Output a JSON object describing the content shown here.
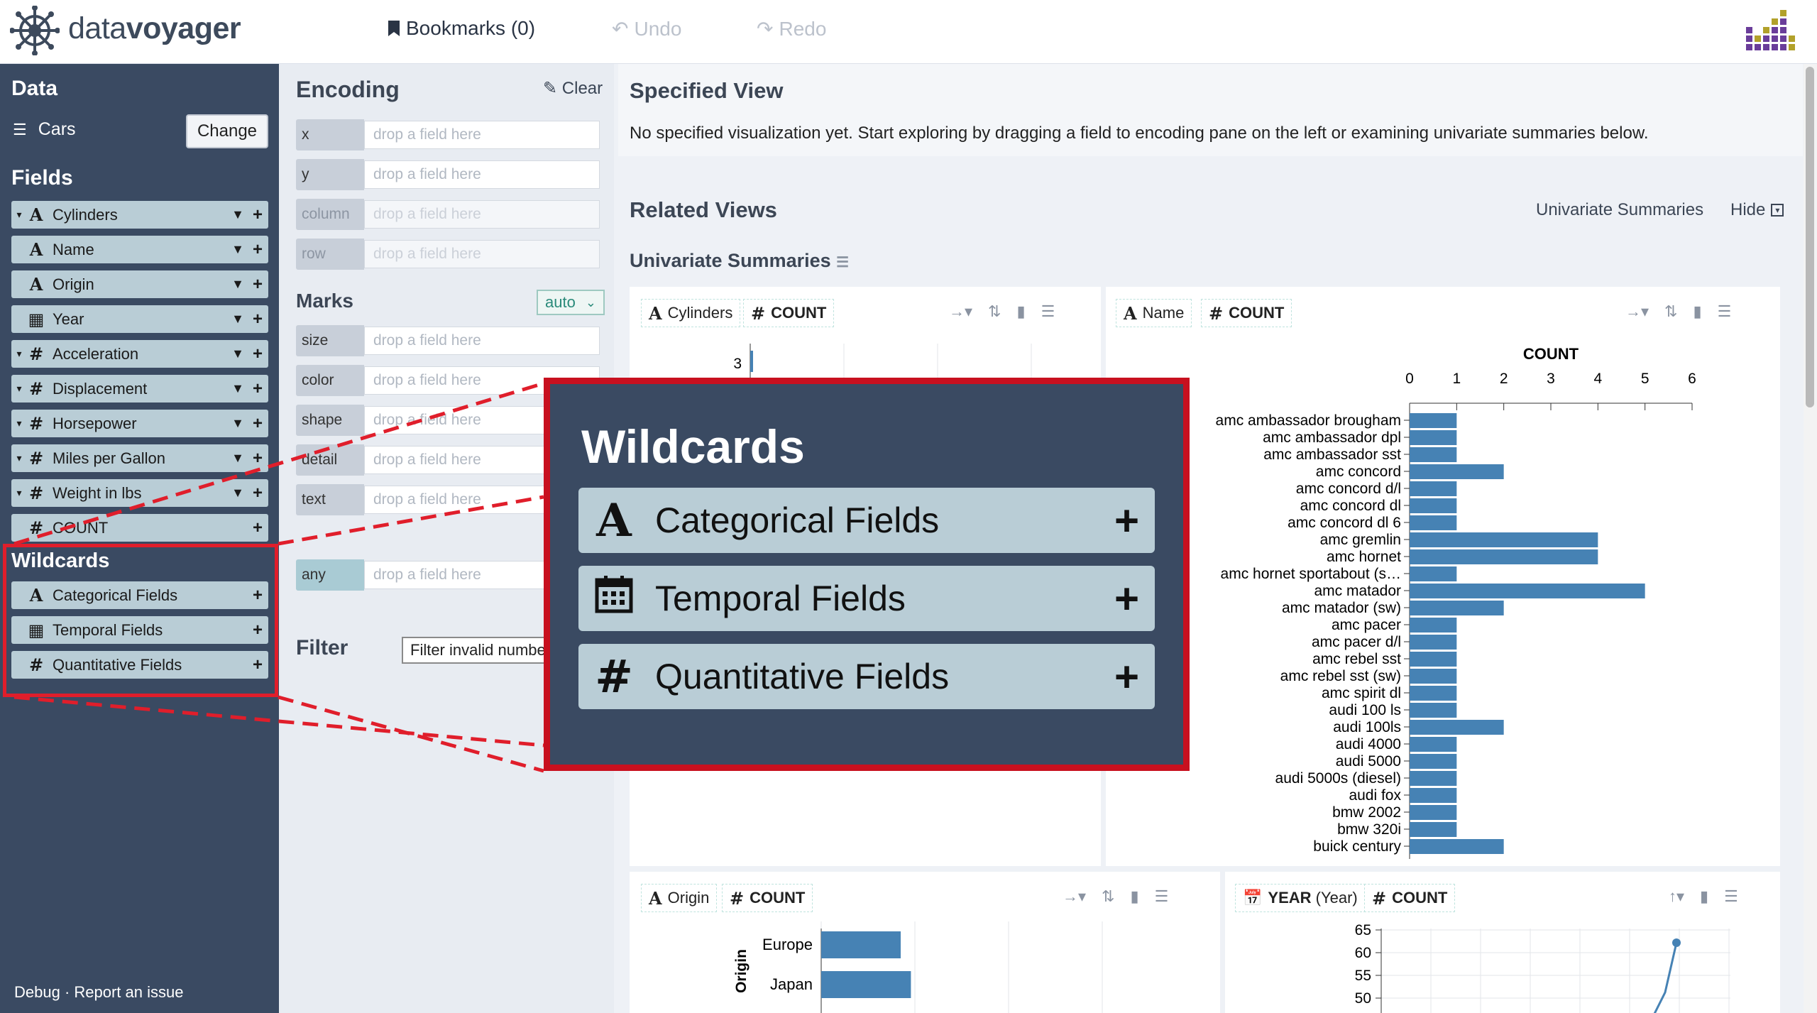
{
  "app": {
    "name_light": "data",
    "name_bold": "voyager"
  },
  "toolbar": {
    "bookmarks": "Bookmarks (0)",
    "undo": "Undo",
    "redo": "Redo"
  },
  "data_pane": {
    "title": "Data",
    "dataset": "Cars",
    "change_label": "Change",
    "fields_title": "Fields",
    "fields": [
      {
        "type": "A",
        "name": "Cylinders",
        "caret": true,
        "filter": true
      },
      {
        "type": "A",
        "name": "Name",
        "caret": false,
        "filter": true
      },
      {
        "type": "A",
        "name": "Origin",
        "caret": false,
        "filter": true
      },
      {
        "type": "calendar",
        "name": "Year",
        "caret": false,
        "filter": true
      },
      {
        "type": "#",
        "name": "Acceleration",
        "caret": true,
        "filter": true
      },
      {
        "type": "#",
        "name": "Displacement",
        "caret": true,
        "filter": true
      },
      {
        "type": "#",
        "name": "Horsepower",
        "caret": true,
        "filter": true
      },
      {
        "type": "#",
        "name": "Miles per Gallon",
        "caret": true,
        "filter": true
      },
      {
        "type": "#",
        "name": "Weight in lbs",
        "caret": true,
        "filter": true
      },
      {
        "type": "#",
        "name": "COUNT",
        "caret": false,
        "filter": false
      }
    ],
    "wildcards_title": "Wildcards",
    "wildcards": [
      {
        "type": "A",
        "name": "Categorical Fields"
      },
      {
        "type": "calendar",
        "name": "Temporal Fields"
      },
      {
        "type": "#",
        "name": "Quantitative Fields"
      }
    ],
    "footer": "Debug · Report an issue"
  },
  "encoding": {
    "title": "Encoding",
    "clear": "Clear",
    "placeholder": "drop a field here",
    "channels": [
      "x",
      "y",
      "column",
      "row"
    ],
    "marks_title": "Marks",
    "mark_value": "auto",
    "mark_channels": [
      "size",
      "color",
      "shape",
      "detail",
      "text"
    ],
    "wildcard_channel": "any",
    "filter_title": "Filter",
    "filter_value": "Filter invalid numbers"
  },
  "specified": {
    "title": "Specified View",
    "text": "No specified visualization yet. Start exploring by dragging a field to encoding pane on the left or examining univariate summaries below."
  },
  "related": {
    "title": "Related Views",
    "univariate_link": "Univariate Summaries",
    "hide": "Hide",
    "section": "Univariate Summaries"
  },
  "cards": {
    "cyl": {
      "field": "Cylinders",
      "count": "COUNT",
      "tick": "3"
    },
    "name": {
      "field": "Name",
      "count": "COUNT"
    },
    "origin": {
      "field": "Origin",
      "count": "COUNT"
    },
    "year": {
      "field": "YEAR (Year)",
      "field_bold": "YEAR",
      "field_rest": " (Year)",
      "count": "COUNT"
    }
  },
  "zoom": {
    "title": "Wildcards",
    "items": [
      "Categorical Fields",
      "Temporal Fields",
      "Quantitative Fields"
    ]
  },
  "colors": {
    "bar": "#4682b4",
    "sidebar": "#3a4a62",
    "pill": "#b9cdd6",
    "highlight": "#e01e2b"
  },
  "chart_data": [
    {
      "type": "bar",
      "title": "COUNT",
      "categories": [
        "amc ambassador brougham",
        "amc ambassador dpl",
        "amc ambassador sst",
        "amc concord",
        "amc concord d/l",
        "amc concord dl",
        "amc concord dl 6",
        "amc gremlin",
        "amc hornet",
        "amc hornet sportabout (s…",
        "amc matador",
        "amc matador (sw)",
        "amc pacer",
        "amc pacer d/l",
        "amc rebel sst",
        "amc rebel sst (sw)",
        "amc spirit dl",
        "audi 100 ls",
        "audi 100ls",
        "audi 4000",
        "audi 5000",
        "audi 5000s (diesel)",
        "audi fox",
        "bmw 2002",
        "bmw 320i",
        "buick century"
      ],
      "values": [
        1,
        1,
        1,
        2,
        1,
        1,
        1,
        4,
        4,
        1,
        5,
        2,
        1,
        1,
        1,
        1,
        1,
        1,
        2,
        1,
        1,
        1,
        1,
        1,
        1,
        2
      ],
      "xlim": [
        0,
        6
      ],
      "xticks": [
        "0",
        "1",
        "2",
        "3",
        "4",
        "5",
        "6"
      ]
    },
    {
      "type": "bar",
      "ylabel": "Origin",
      "categories": [
        "Europe",
        "Japan"
      ],
      "values": [
        70,
        79
      ]
    },
    {
      "type": "line",
      "yticks": [
        "65",
        "60",
        "55",
        "50"
      ]
    }
  ]
}
